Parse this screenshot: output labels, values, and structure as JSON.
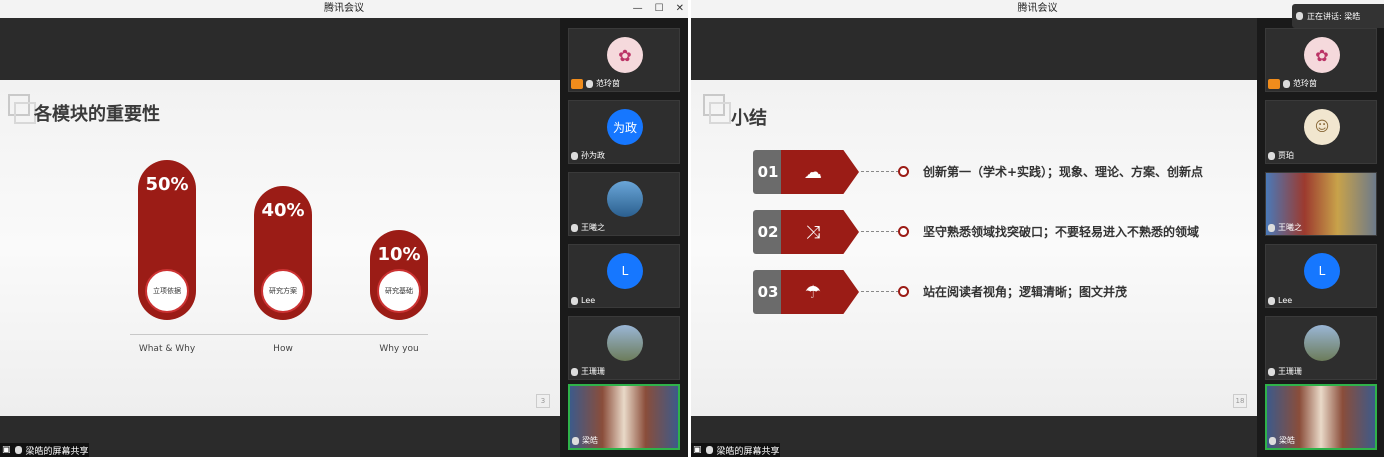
{
  "left_window": {
    "title": "腾讯会议",
    "controls": [
      "—",
      "☐",
      "✕"
    ],
    "slide": {
      "title": "各模块的重要性",
      "bars": [
        {
          "percent": "50%",
          "circle_label": "立项依据",
          "x_label": "What & Why",
          "value": 50
        },
        {
          "percent": "40%",
          "circle_label": "研究方案",
          "x_label": "How",
          "value": 40
        },
        {
          "percent": "10%",
          "circle_label": "研究基础",
          "x_label": "Why you",
          "value": 10
        }
      ],
      "page": "3"
    },
    "share_label": "梁皓的屏幕共享",
    "participants": [
      {
        "name": "范玲茵",
        "type": "photo",
        "host": true
      },
      {
        "name": "孙为政",
        "type": "initials",
        "initials": "为政",
        "color": "#1677ff"
      },
      {
        "name": "王曦之",
        "type": "photo"
      },
      {
        "name": "Lee",
        "type": "initials",
        "initials": "L",
        "color": "#1677ff"
      },
      {
        "name": "王珊珊",
        "type": "photo"
      },
      {
        "name": "梁皓",
        "type": "video",
        "active": true
      }
    ]
  },
  "right_window": {
    "title": "腾讯会议",
    "speaking": "正在讲话: 梁皓",
    "slide": {
      "title": "小结",
      "items": [
        {
          "num": "01",
          "icon": "cloud-download-icon",
          "glyph": "☁",
          "text": "创新第一（学术+实践）；现象、理论、方案、创新点"
        },
        {
          "num": "02",
          "icon": "shuffle-icon",
          "glyph": "⤨",
          "text": "坚守熟悉领域找突破口；不要轻易进入不熟悉的领域"
        },
        {
          "num": "03",
          "icon": "umbrella-icon",
          "glyph": "☂",
          "text": "站在阅读者视角；逻辑清晰；图文并茂"
        }
      ],
      "page": "18"
    },
    "share_label": "梁皓的屏幕共享",
    "participants": [
      {
        "name": "范玲茵",
        "type": "photo",
        "host": true
      },
      {
        "name": "贾珀",
        "type": "photo"
      },
      {
        "name": "王曦之",
        "type": "video"
      },
      {
        "name": "Lee",
        "type": "initials",
        "initials": "L",
        "color": "#1677ff"
      },
      {
        "name": "王珊珊",
        "type": "photo"
      },
      {
        "name": "梁皓",
        "type": "video",
        "active": true
      }
    ]
  }
}
